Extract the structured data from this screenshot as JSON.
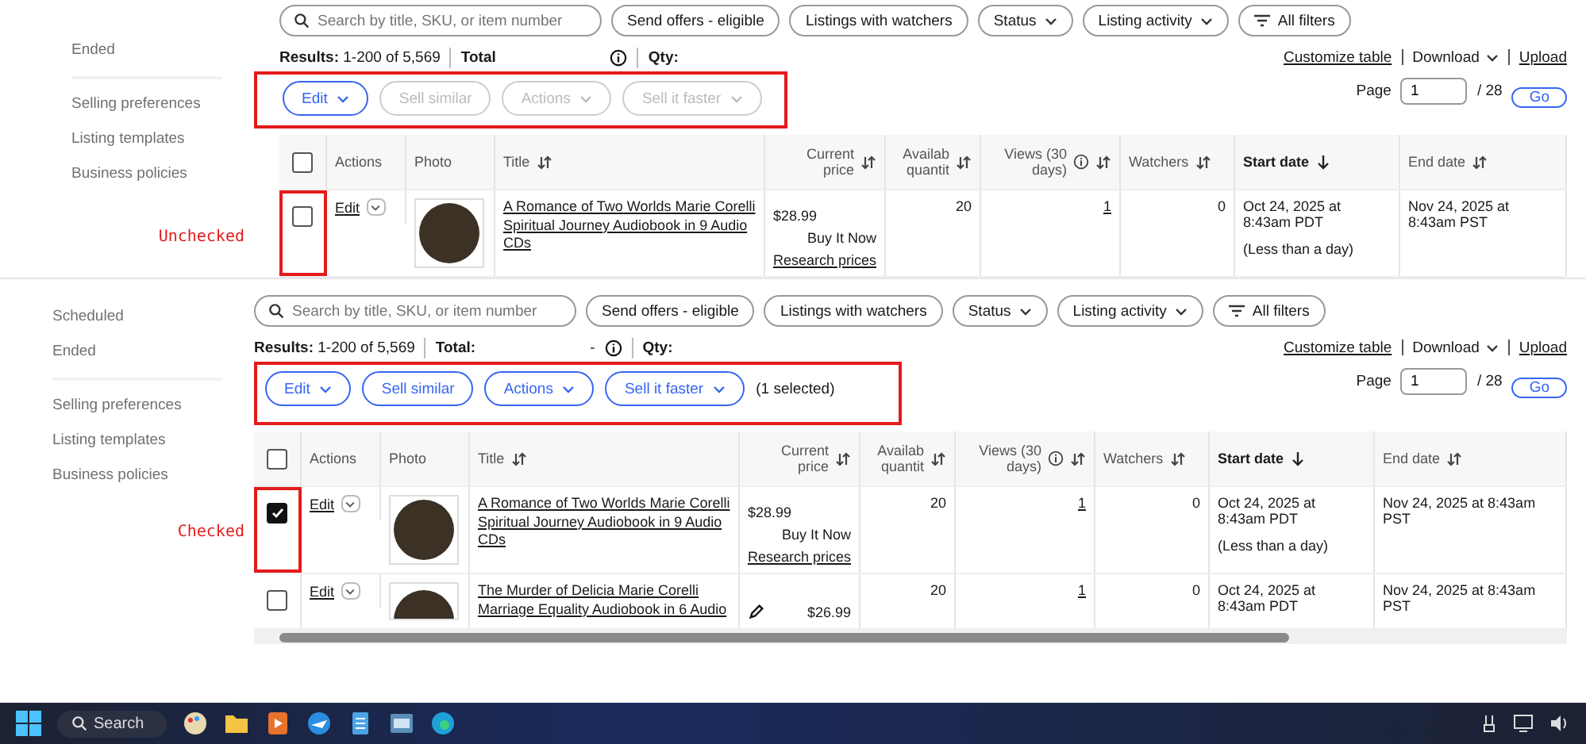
{
  "panels": [
    {
      "status_items": [
        "Ended"
      ],
      "settings_items": [
        "Selling preferences",
        "Listing templates",
        "Business policies"
      ],
      "search": {
        "placeholder": "Search by title, SKU, or item number"
      },
      "chips": [
        {
          "label": "Send offers - eligible",
          "kind": "plain"
        },
        {
          "label": "Listings with watchers",
          "kind": "plain"
        },
        {
          "label": "Status",
          "kind": "dropdown"
        },
        {
          "label": "Listing activity",
          "kind": "dropdown"
        },
        {
          "label": "All filters",
          "kind": "filter"
        }
      ],
      "results": {
        "label": "Results:",
        "range": "1-200 of 5,569",
        "total": "Total",
        "qty": "Qty:"
      },
      "links": {
        "customize": "Customize table",
        "download": "Download",
        "upload": "Upload"
      },
      "pager": {
        "label": "Page",
        "value": "1",
        "of": "/ 28",
        "go": "Go"
      },
      "action_buttons": [
        {
          "label": "Edit",
          "kind": "dropdown",
          "disabled": false
        },
        {
          "label": "Sell similar",
          "kind": "plain",
          "disabled": true
        },
        {
          "label": "Actions",
          "kind": "dropdown",
          "disabled": true
        },
        {
          "label": "Sell it faster",
          "kind": "dropdown",
          "disabled": true
        }
      ],
      "annotation": "Unchecked",
      "all_checked": false,
      "columns": [
        {
          "label": "Actions",
          "sortable": false,
          "sorted": false
        },
        {
          "label": "Photo",
          "sortable": false,
          "sorted": false
        },
        {
          "label": "Title",
          "sortable": true,
          "sorted": false
        },
        {
          "label": "Current price",
          "sortable": true,
          "sorted": false
        },
        {
          "label": "Availab quantit",
          "sortable": true,
          "sorted": false
        },
        {
          "label": "Views (30 days)",
          "sortable": true,
          "sorted": false,
          "info": true
        },
        {
          "label": "Watchers",
          "sortable": true,
          "sorted": false
        },
        {
          "label": "Start date",
          "sortable": true,
          "sorted": true
        },
        {
          "label": "End date",
          "sortable": true,
          "sorted": false
        }
      ],
      "rows": [
        {
          "checked": false,
          "highlighted": true,
          "edit": "Edit",
          "title": "A Romance of Two Worlds Marie Corelli Spiritual Journey Audiobook in 9 Audio CDs",
          "price": "$28.99",
          "format": "Buy It Now",
          "research": "Research prices",
          "qty": "20",
          "views": "1",
          "watchers": "0",
          "start": "Oct 24, 2025 at 8:43am PDT",
          "start_note": "(Less than a day)",
          "end": "Nov 24, 2025 at 8:43am PST"
        }
      ]
    },
    {
      "status_items": [
        "Scheduled",
        "Ended"
      ],
      "settings_items": [
        "Selling preferences",
        "Listing templates",
        "Business policies"
      ],
      "search": {
        "placeholder": "Search by title, SKU, or item number"
      },
      "chips": [
        {
          "label": "Send offers - eligible",
          "kind": "plain"
        },
        {
          "label": "Listings with watchers",
          "kind": "plain"
        },
        {
          "label": "Status",
          "kind": "dropdown"
        },
        {
          "label": "Listing activity",
          "kind": "dropdown"
        },
        {
          "label": "All filters",
          "kind": "filter"
        }
      ],
      "results": {
        "label": "Results:",
        "range": "1-200 of 5,569",
        "total": "Total:",
        "total_value": "-",
        "qty": "Qty:"
      },
      "links": {
        "customize": "Customize table",
        "download": "Download",
        "upload": "Upload"
      },
      "pager": {
        "label": "Page",
        "value": "1",
        "of": "/ 28",
        "go": "Go"
      },
      "action_buttons": [
        {
          "label": "Edit",
          "kind": "dropdown",
          "disabled": false
        },
        {
          "label": "Sell similar",
          "kind": "plain",
          "disabled": false
        },
        {
          "label": "Actions",
          "kind": "dropdown",
          "disabled": false
        },
        {
          "label": "Sell it faster",
          "kind": "dropdown",
          "disabled": false
        }
      ],
      "selected_note": "(1 selected)",
      "annotation": "Checked",
      "all_checked": false,
      "columns": [
        {
          "label": "Actions",
          "sortable": false,
          "sorted": false
        },
        {
          "label": "Photo",
          "sortable": false,
          "sorted": false
        },
        {
          "label": "Title",
          "sortable": true,
          "sorted": false
        },
        {
          "label": "Current price",
          "sortable": true,
          "sorted": false
        },
        {
          "label": "Availab quantit",
          "sortable": true,
          "sorted": false
        },
        {
          "label": "Views (30 days)",
          "sortable": true,
          "sorted": false,
          "info": true
        },
        {
          "label": "Watchers",
          "sortable": true,
          "sorted": false
        },
        {
          "label": "Start date",
          "sortable": true,
          "sorted": true
        },
        {
          "label": "End date",
          "sortable": true,
          "sorted": false
        }
      ],
      "rows": [
        {
          "checked": true,
          "highlighted": true,
          "edit": "Edit",
          "title": "A Romance of Two Worlds Marie Corelli Spiritual Journey Audiobook in 9 Audio CDs",
          "price": "$28.99",
          "format": "Buy It Now",
          "research": "Research prices",
          "qty": "20",
          "views": "1",
          "watchers": "0",
          "start": "Oct 24, 2025 at 8:43am PDT",
          "start_note": "(Less than a day)",
          "end": "Nov 24, 2025 at 8:43am PST"
        },
        {
          "checked": false,
          "highlighted": false,
          "edit": "Edit",
          "pencil": true,
          "title": "The Murder of Delicia Marie Corelli Marriage Equality Audiobook in 6 Audio",
          "price": "$26.99",
          "qty": "20",
          "views": "1",
          "watchers": "0",
          "start": "Oct 24, 2025 at 8:43am PDT",
          "end": "Nov 24, 2025 at 8:43am PST"
        }
      ]
    }
  ],
  "taskbar": {
    "search": "Search"
  }
}
